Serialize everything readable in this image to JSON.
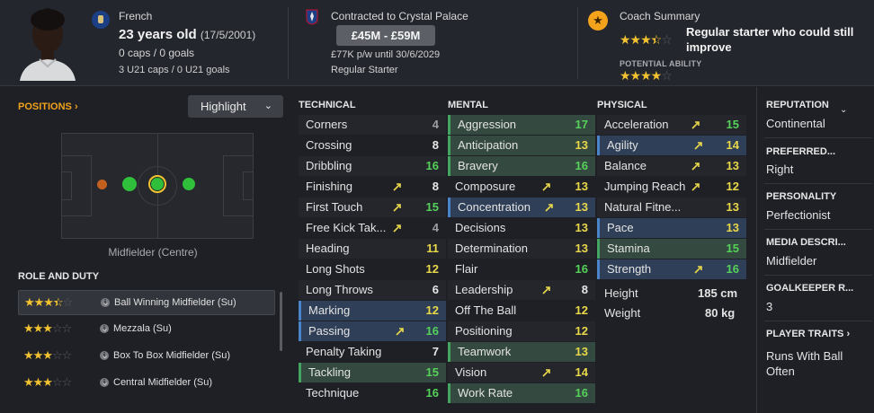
{
  "header": {
    "nationality": "French",
    "age": "23 years old",
    "dob": "(17/5/2001)",
    "caps": "0 caps / 0 goals",
    "u21_caps": "3 U21 caps / 0 U21 goals",
    "contract": "Contracted to Crystal Palace",
    "value": "£45M - £59M",
    "wage": "£77K p/w until 30/6/2029",
    "status": "Regular Starter",
    "coach_title": "Coach Summary",
    "coach_summary": "Regular starter who could still improve",
    "potential_label": "POTENTIAL ABILITY",
    "current_ability_stars": 3.5,
    "potential_ability_stars": 4
  },
  "left": {
    "positions_label": "POSITIONS ›",
    "highlight_label": "Highlight",
    "position_name": "Midfielder (Centre)",
    "role_title": "ROLE AND DUTY",
    "roles": [
      {
        "name": "Ball Winning Midfielder (Su)",
        "stars": 3.5
      },
      {
        "name": "Mezzala (Su)",
        "stars": 3
      },
      {
        "name": "Box To Box Midfielder (Su)",
        "stars": 3
      },
      {
        "name": "Central Midfielder (Su)",
        "stars": 3
      }
    ]
  },
  "technical": {
    "title": "TECHNICAL",
    "items": [
      {
        "name": "Corners",
        "value": "4"
      },
      {
        "name": "Crossing",
        "value": "8"
      },
      {
        "name": "Dribbling",
        "value": "16"
      },
      {
        "name": "Finishing",
        "value": "8"
      },
      {
        "name": "First Touch",
        "value": "15"
      },
      {
        "name": "Free Kick Tak...",
        "value": "4"
      },
      {
        "name": "Heading",
        "value": "11"
      },
      {
        "name": "Long Shots",
        "value": "12"
      },
      {
        "name": "Long Throws",
        "value": "6"
      },
      {
        "name": "Marking",
        "value": "12"
      },
      {
        "name": "Passing",
        "value": "16"
      },
      {
        "name": "Penalty Taking",
        "value": "7"
      },
      {
        "name": "Tackling",
        "value": "15"
      },
      {
        "name": "Technique",
        "value": "16"
      }
    ]
  },
  "mental": {
    "title": "MENTAL",
    "items": [
      {
        "name": "Aggression",
        "value": "17"
      },
      {
        "name": "Anticipation",
        "value": "13"
      },
      {
        "name": "Bravery",
        "value": "16"
      },
      {
        "name": "Composure",
        "value": "13"
      },
      {
        "name": "Concentration",
        "value": "13"
      },
      {
        "name": "Decisions",
        "value": "13"
      },
      {
        "name": "Determination",
        "value": "13"
      },
      {
        "name": "Flair",
        "value": "16"
      },
      {
        "name": "Leadership",
        "value": "8"
      },
      {
        "name": "Off The Ball",
        "value": "12"
      },
      {
        "name": "Positioning",
        "value": "12"
      },
      {
        "name": "Teamwork",
        "value": "13"
      },
      {
        "name": "Vision",
        "value": "14"
      },
      {
        "name": "Work Rate",
        "value": "16"
      }
    ]
  },
  "physical": {
    "title": "PHYSICAL",
    "items": [
      {
        "name": "Acceleration",
        "value": "15"
      },
      {
        "name": "Agility",
        "value": "14"
      },
      {
        "name": "Balance",
        "value": "13"
      },
      {
        "name": "Jumping Reach",
        "value": "12"
      },
      {
        "name": "Natural Fitne...",
        "value": "13"
      },
      {
        "name": "Pace",
        "value": "13"
      },
      {
        "name": "Stamina",
        "value": "15"
      },
      {
        "name": "Strength",
        "value": "16"
      }
    ],
    "height_label": "Height",
    "height_value": "185 cm",
    "weight_label": "Weight",
    "weight_value": "80 kg"
  },
  "info": {
    "reputation_label": "REPUTATION",
    "reputation_value": "Continental",
    "preferred_label": "PREFERRED...",
    "preferred_value": "Right",
    "personality_label": "PERSONALITY",
    "personality_value": "Perfectionist",
    "media_label": "MEDIA DESCRI...",
    "media_value": "Midfielder",
    "gk_label": "GOALKEEPER R...",
    "gk_value": "3",
    "traits_label": "PLAYER TRAITS",
    "traits_value": "Runs With Ball Often"
  },
  "colors": {
    "accent": "#f2a31b",
    "highlight_green": "#43a560",
    "highlight_blue": "#4a84c8",
    "value_green": "#56d25a",
    "value_yellow": "#e9d84a"
  }
}
